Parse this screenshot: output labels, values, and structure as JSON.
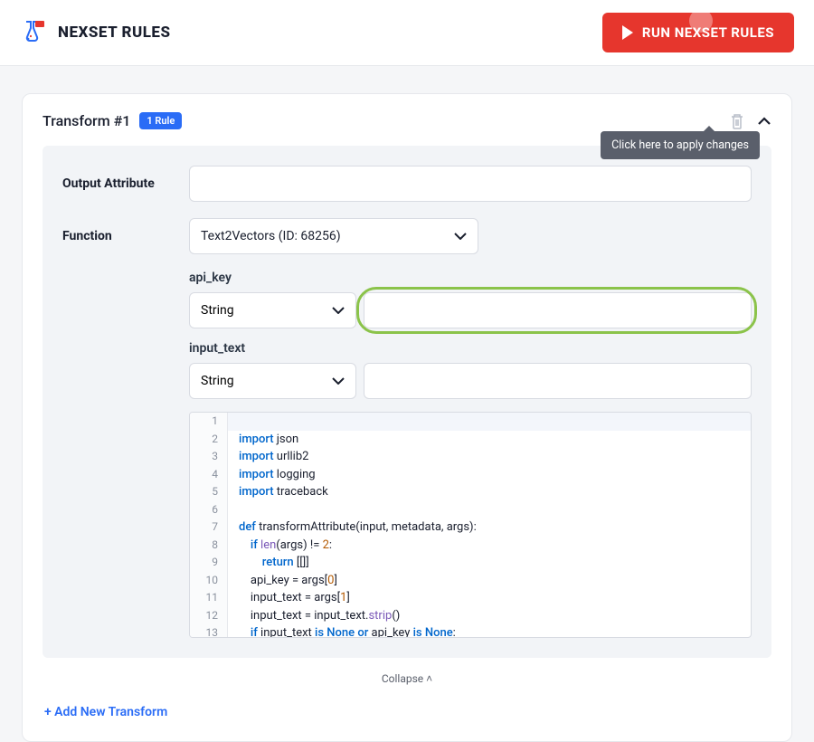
{
  "header": {
    "title": "NEXSET RULES",
    "run_button": "RUN NEXSET RULES"
  },
  "tooltip": "Click here to apply changes",
  "card": {
    "title": "Transform #1",
    "badge": "1 Rule",
    "output_attr_label": "Output Attribute",
    "output_attr_value": "",
    "function_label": "Function",
    "function_value": "Text2Vectors (ID: 68256)",
    "params": [
      {
        "name": "api_key",
        "type": "String",
        "value": ""
      },
      {
        "name": "input_text",
        "type": "String",
        "value": ""
      }
    ],
    "code_lines": [
      "",
      "import json",
      "import urllib2",
      "import logging",
      "import traceback",
      "",
      "def transformAttribute(input, metadata, args):",
      "    if len(args) != 2:",
      "        return [[]]",
      "    api_key = args[0]",
      "    input_text = args[1]",
      "    input_text = input_text.strip()",
      "    if input_text is None or api_key is None:"
    ],
    "collapse": "Collapse",
    "add_transform": "+ Add New Transform"
  }
}
